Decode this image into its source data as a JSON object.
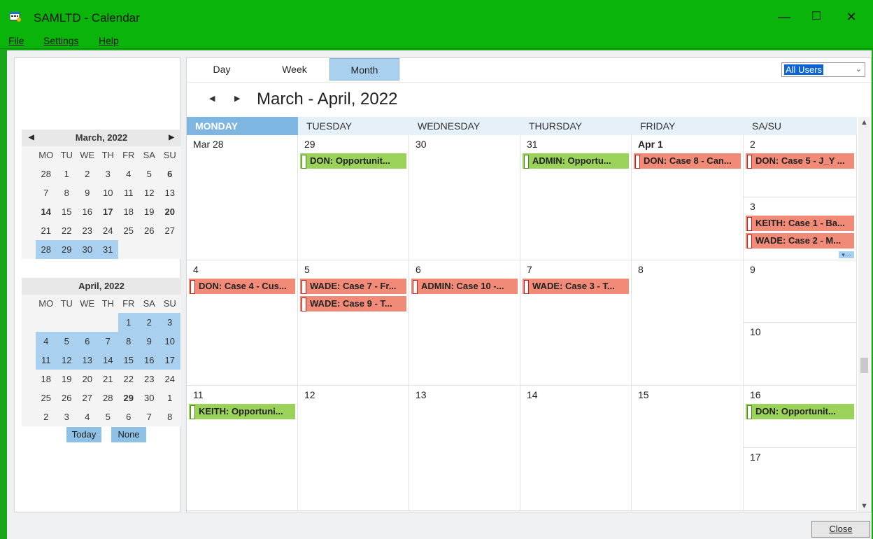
{
  "app": {
    "title": "SAMLTD - Calendar"
  },
  "menu": [
    "File",
    "Settings",
    "Help"
  ],
  "window_controls": {
    "minimize": "—",
    "maximize": "☐",
    "close": "✕"
  },
  "mini_calendars": [
    {
      "title": "March, 2022",
      "weekday_headers": [
        "MO",
        "TU",
        "WE",
        "TH",
        "FR",
        "SA",
        "SU"
      ],
      "days": [
        "28",
        "1",
        "2",
        "3",
        "4",
        "5",
        "6",
        "7",
        "8",
        "9",
        "10",
        "11",
        "12",
        "13",
        "14",
        "15",
        "16",
        "17",
        "18",
        "19",
        "20",
        "21",
        "22",
        "23",
        "24",
        "25",
        "26",
        "27",
        "28",
        "29",
        "30",
        "31"
      ]
    },
    {
      "title": "April, 2022",
      "weekday_headers": [
        "MO",
        "TU",
        "WE",
        "TH",
        "FR",
        "SA",
        "SU"
      ],
      "days": [
        "1",
        "2",
        "3",
        "4",
        "5",
        "6",
        "7",
        "8",
        "9",
        "10",
        "11",
        "12",
        "13",
        "14",
        "15",
        "16",
        "17",
        "18",
        "19",
        "20",
        "21",
        "22",
        "23",
        "24",
        "25",
        "26",
        "27",
        "28",
        "29",
        "30",
        "1",
        "2",
        "3",
        "4",
        "5",
        "6",
        "7",
        "8"
      ]
    }
  ],
  "buttons": {
    "today": "Today",
    "none": "None",
    "close": "Close"
  },
  "view_tabs": [
    "Day",
    "Week",
    "Month"
  ],
  "active_tab": "Month",
  "user_filter": "All Users",
  "range_title": "March - April, 2022",
  "day_headers": [
    "MONDAY",
    "TUESDAY",
    "WEDNESDAY",
    "THURSDAY",
    "FRIDAY",
    "SA/SU"
  ],
  "weeks": [
    {
      "days": [
        {
          "label": "Mar 28",
          "events": []
        },
        {
          "label": "29",
          "events": [
            {
              "text": "DON: Opportunit...",
              "type": "green"
            }
          ]
        },
        {
          "label": "30",
          "events": []
        },
        {
          "label": "31",
          "events": [
            {
              "text": "ADMIN: Opportu...",
              "type": "green"
            }
          ]
        },
        {
          "label": "Apr 1",
          "events": [
            {
              "text": "DON: Case 8 - Can...",
              "type": "red"
            }
          ]
        },
        {
          "label": "2",
          "events": [
            {
              "text": "DON: Case 5 - J_Y ...",
              "type": "red"
            }
          ]
        },
        {
          "label": "3",
          "events": [
            {
              "text": "KEITH: Case 1 - Ba...",
              "type": "red"
            },
            {
              "text": "WADE: Case 2 - M...",
              "type": "red"
            }
          ]
        }
      ]
    },
    {
      "days": [
        {
          "label": "4",
          "events": [
            {
              "text": "DON: Case 4 - Cus...",
              "type": "red"
            }
          ]
        },
        {
          "label": "5",
          "events": [
            {
              "text": "WADE: Case 7 - Fr...",
              "type": "red"
            },
            {
              "text": "WADE: Case 9 - T...",
              "type": "red"
            }
          ]
        },
        {
          "label": "6",
          "events": [
            {
              "text": "ADMIN: Case 10 -...",
              "type": "red"
            }
          ]
        },
        {
          "label": "7",
          "events": [
            {
              "text": "WADE: Case 3 - T...",
              "type": "red"
            }
          ]
        },
        {
          "label": "8",
          "events": []
        },
        {
          "label": "9",
          "events": []
        },
        {
          "label": "10",
          "events": []
        }
      ]
    },
    {
      "days": [
        {
          "label": "11",
          "events": [
            {
              "text": "KEITH: Opportuni...",
              "type": "green"
            }
          ]
        },
        {
          "label": "12",
          "events": []
        },
        {
          "label": "13",
          "events": []
        },
        {
          "label": "14",
          "events": []
        },
        {
          "label": "15",
          "events": []
        },
        {
          "label": "16",
          "events": [
            {
              "text": "DON: Opportunit...",
              "type": "green"
            }
          ]
        },
        {
          "label": "17",
          "events": []
        }
      ]
    }
  ],
  "colors": {
    "titlebar": "#0ab40a",
    "active_tab": "#a9d1ef",
    "event_green": "#9bd25a",
    "event_red": "#f28a78",
    "today_header": "#7fb6e1"
  }
}
